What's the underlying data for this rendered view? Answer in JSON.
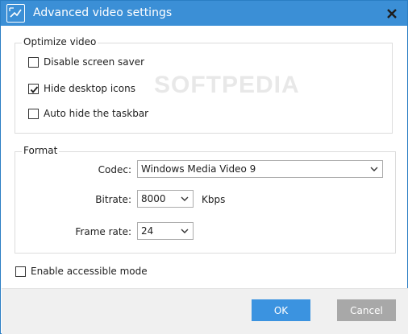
{
  "window": {
    "title": "Advanced video settings"
  },
  "optimize": {
    "legend": "Optimize video",
    "options": [
      {
        "label": "Disable screen saver",
        "checked": false
      },
      {
        "label": "Hide desktop icons",
        "checked": true
      },
      {
        "label": "Auto hide the taskbar",
        "checked": false
      }
    ]
  },
  "format": {
    "legend": "Format",
    "codec": {
      "label": "Codec:",
      "value": "Windows Media Video 9"
    },
    "bitrate": {
      "label": "Bitrate:",
      "value": "8000",
      "unit": "Kbps"
    },
    "framerate": {
      "label": "Frame rate:",
      "value": "24"
    }
  },
  "accessible": {
    "label": "Enable accessible mode",
    "checked": false
  },
  "buttons": {
    "ok": "OK",
    "cancel": "Cancel"
  },
  "watermark": "SOFTPEDIA",
  "colors": {
    "titlebar": "#3b8fd6",
    "ok_button": "#3b93e0",
    "cancel_button": "#a8a8a8"
  }
}
